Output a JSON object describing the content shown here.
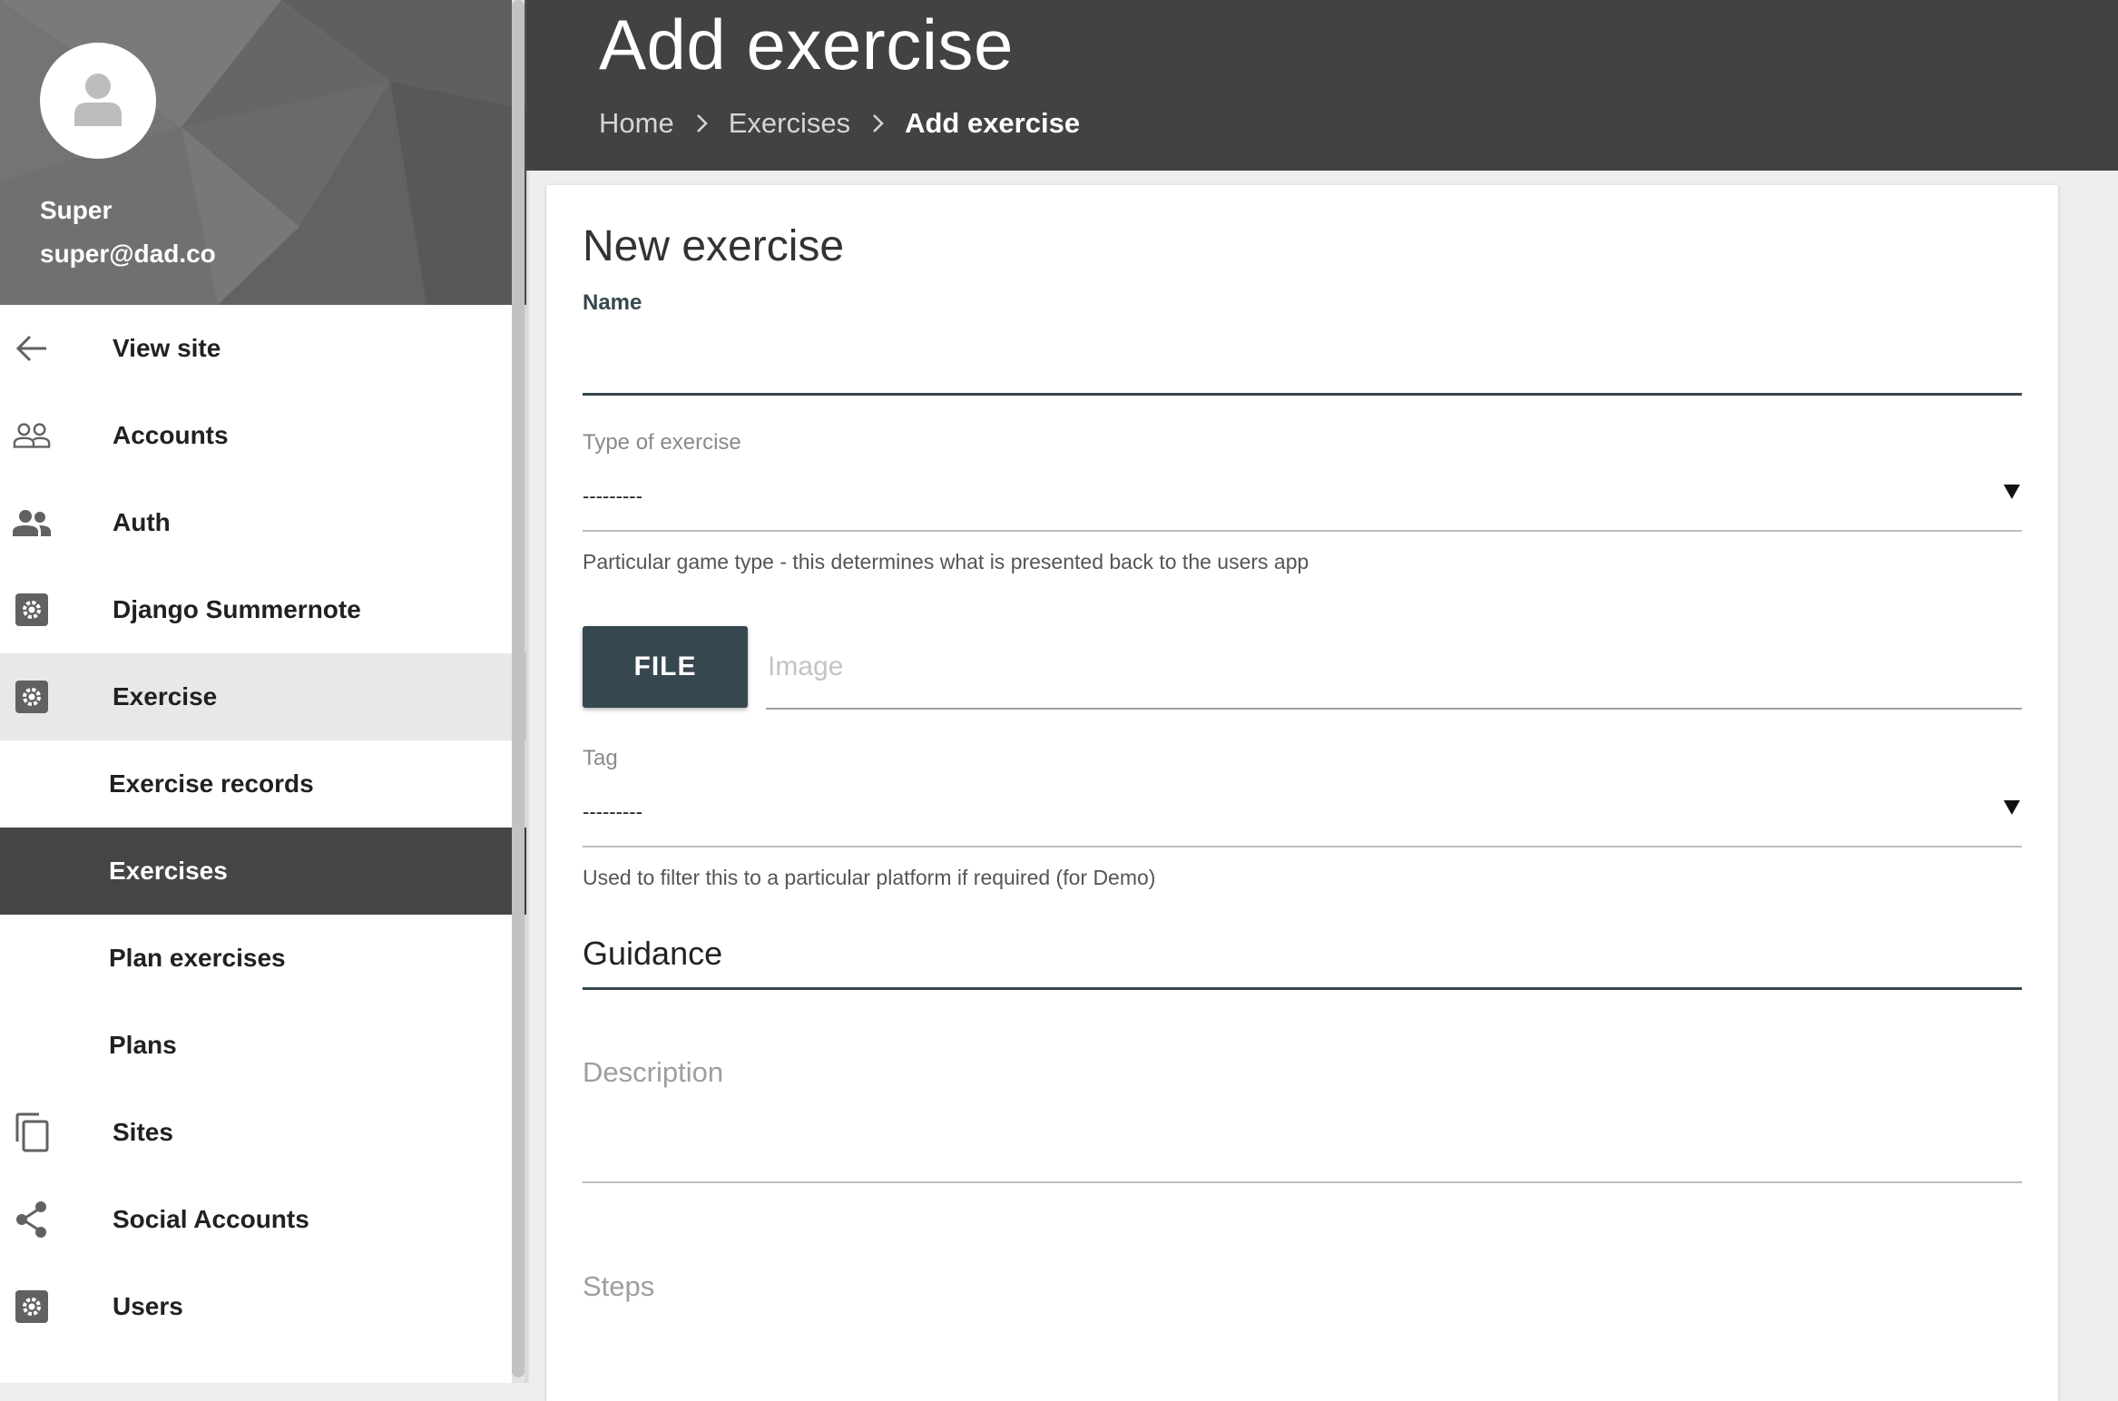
{
  "user": {
    "name": "Super",
    "email": "super@dad.co"
  },
  "sidebar": {
    "items": [
      {
        "label": "View site",
        "icon": "arrow-left-icon"
      },
      {
        "label": "Accounts",
        "icon": "people-outline-icon"
      },
      {
        "label": "Auth",
        "icon": "people-icon"
      },
      {
        "label": "Django Summernote",
        "icon": "gear-icon"
      },
      {
        "label": "Exercise",
        "icon": "gear-icon"
      },
      {
        "label": "Exercise records"
      },
      {
        "label": "Exercises"
      },
      {
        "label": "Plan exercises"
      },
      {
        "label": "Plans"
      },
      {
        "label": "Sites",
        "icon": "copy-icon"
      },
      {
        "label": "Social Accounts",
        "icon": "share-icon"
      },
      {
        "label": "Users",
        "icon": "gear-icon"
      }
    ],
    "active_group": "Exercise",
    "selected_item": "Exercises"
  },
  "header": {
    "title": "Add exercise",
    "breadcrumb": [
      "Home",
      "Exercises",
      "Add exercise"
    ]
  },
  "form": {
    "title": "New exercise",
    "name_label": "Name",
    "name_value": "",
    "type_label": "Type of exercise",
    "type_value": "---------",
    "type_help": "Particular game type - this determines what is presented back to the users app",
    "file_button": "FILE",
    "image_placeholder": "Image",
    "tag_label": "Tag",
    "tag_value": "---------",
    "tag_help": "Used to filter this to a particular platform if required (for Demo)",
    "guidance_title": "Guidance",
    "description_placeholder": "Description",
    "steps_placeholder": "Steps"
  },
  "colors": {
    "header_bg": "#424242",
    "accent": "#37474f",
    "selected_bg": "#454545",
    "group_active_bg": "#e8e8e8"
  }
}
